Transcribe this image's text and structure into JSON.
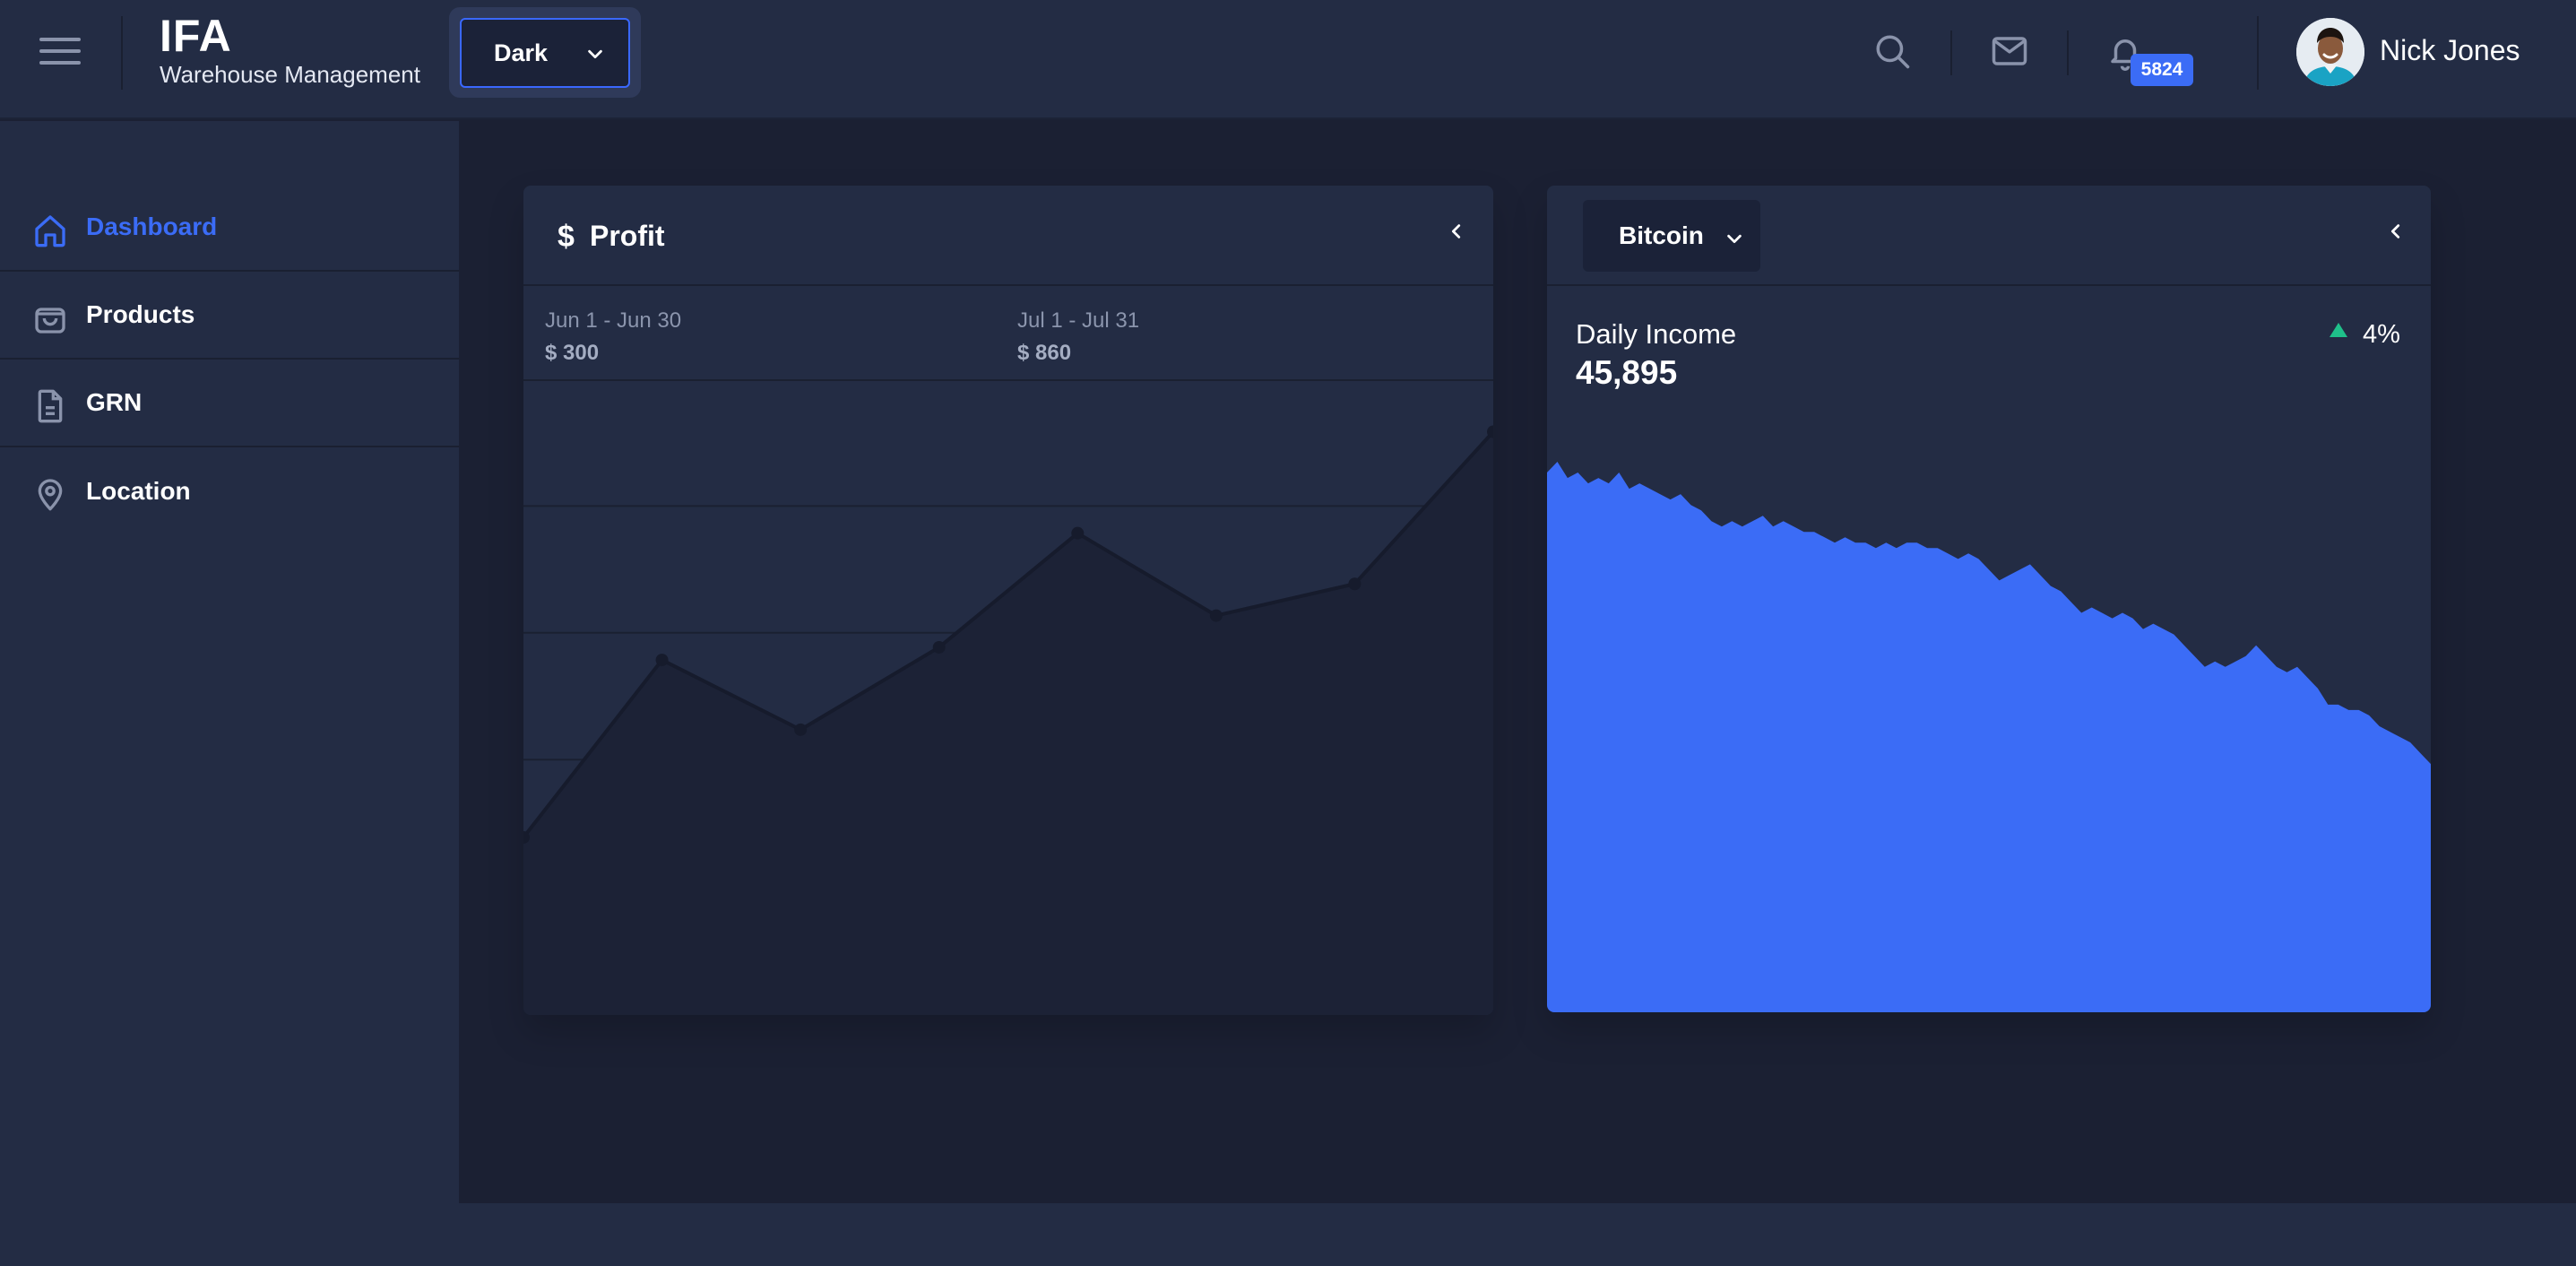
{
  "header": {
    "brand_title": "IFA",
    "brand_subtitle": "Warehouse Management",
    "theme_select": {
      "selected": "Dark"
    },
    "notification_count": "5824",
    "user_name": "Nick Jones",
    "icons": [
      "menu-icon",
      "search-icon",
      "mail-icon",
      "bell-icon",
      "chevron-down-icon"
    ]
  },
  "sidebar": {
    "items": [
      {
        "label": "Dashboard",
        "icon": "home-icon",
        "active": true
      },
      {
        "label": "Products",
        "icon": "shopping-bag-icon",
        "active": false
      },
      {
        "label": "GRN",
        "icon": "document-icon",
        "active": false
      },
      {
        "label": "Location",
        "icon": "map-pin-icon",
        "active": false
      }
    ]
  },
  "profit_card": {
    "icon_glyph": "$",
    "title": "Profit",
    "periods": [
      {
        "range": "Jun 1 - Jun 30",
        "amount": "$ 300"
      },
      {
        "range": "Jul 1 - Jul 31",
        "amount": "$ 860"
      }
    ]
  },
  "coin_card": {
    "selected_coin": "Bitcoin",
    "metric_label": "Daily Income",
    "metric_value": "45,895",
    "change": "4%",
    "change_direction": "up"
  },
  "colors": {
    "accent": "#3b6cf6",
    "positive": "#1fc08a",
    "panel": "#232c44",
    "background": "#1b2033"
  },
  "chart_data": [
    {
      "type": "line",
      "title": "",
      "xlabel": "",
      "ylabel": "",
      "grid": true,
      "x": [
        1,
        2,
        3,
        4,
        5,
        6,
        7,
        8
      ],
      "series": [
        {
          "values": [
            28,
            56,
            45,
            58,
            76,
            63,
            68,
            92
          ]
        }
      ],
      "ylim": [
        0,
        100
      ],
      "legend": "none"
    },
    {
      "type": "area",
      "title": "",
      "xlabel": "",
      "ylabel": "",
      "grid": false,
      "series": [
        {
          "values": [
            100,
            102,
            99,
            100,
            98,
            99,
            98,
            100,
            97,
            98,
            97,
            96,
            95,
            96,
            94,
            93,
            91,
            90,
            91,
            90,
            91,
            92,
            90,
            91,
            90,
            89,
            89,
            88,
            87,
            88,
            87,
            87,
            86,
            87,
            86,
            87,
            87,
            86,
            86,
            85,
            84,
            85,
            84,
            82,
            80,
            81,
            82,
            83,
            81,
            79,
            78,
            76,
            74,
            75,
            74,
            73,
            74,
            73,
            71,
            72,
            71,
            70,
            68,
            66,
            64,
            65,
            64,
            65,
            66,
            68,
            66,
            64,
            63,
            64,
            62,
            60,
            57,
            57,
            56,
            56,
            55,
            53,
            52,
            51,
            50,
            48,
            46
          ]
        }
      ],
      "legend": "none"
    }
  ]
}
